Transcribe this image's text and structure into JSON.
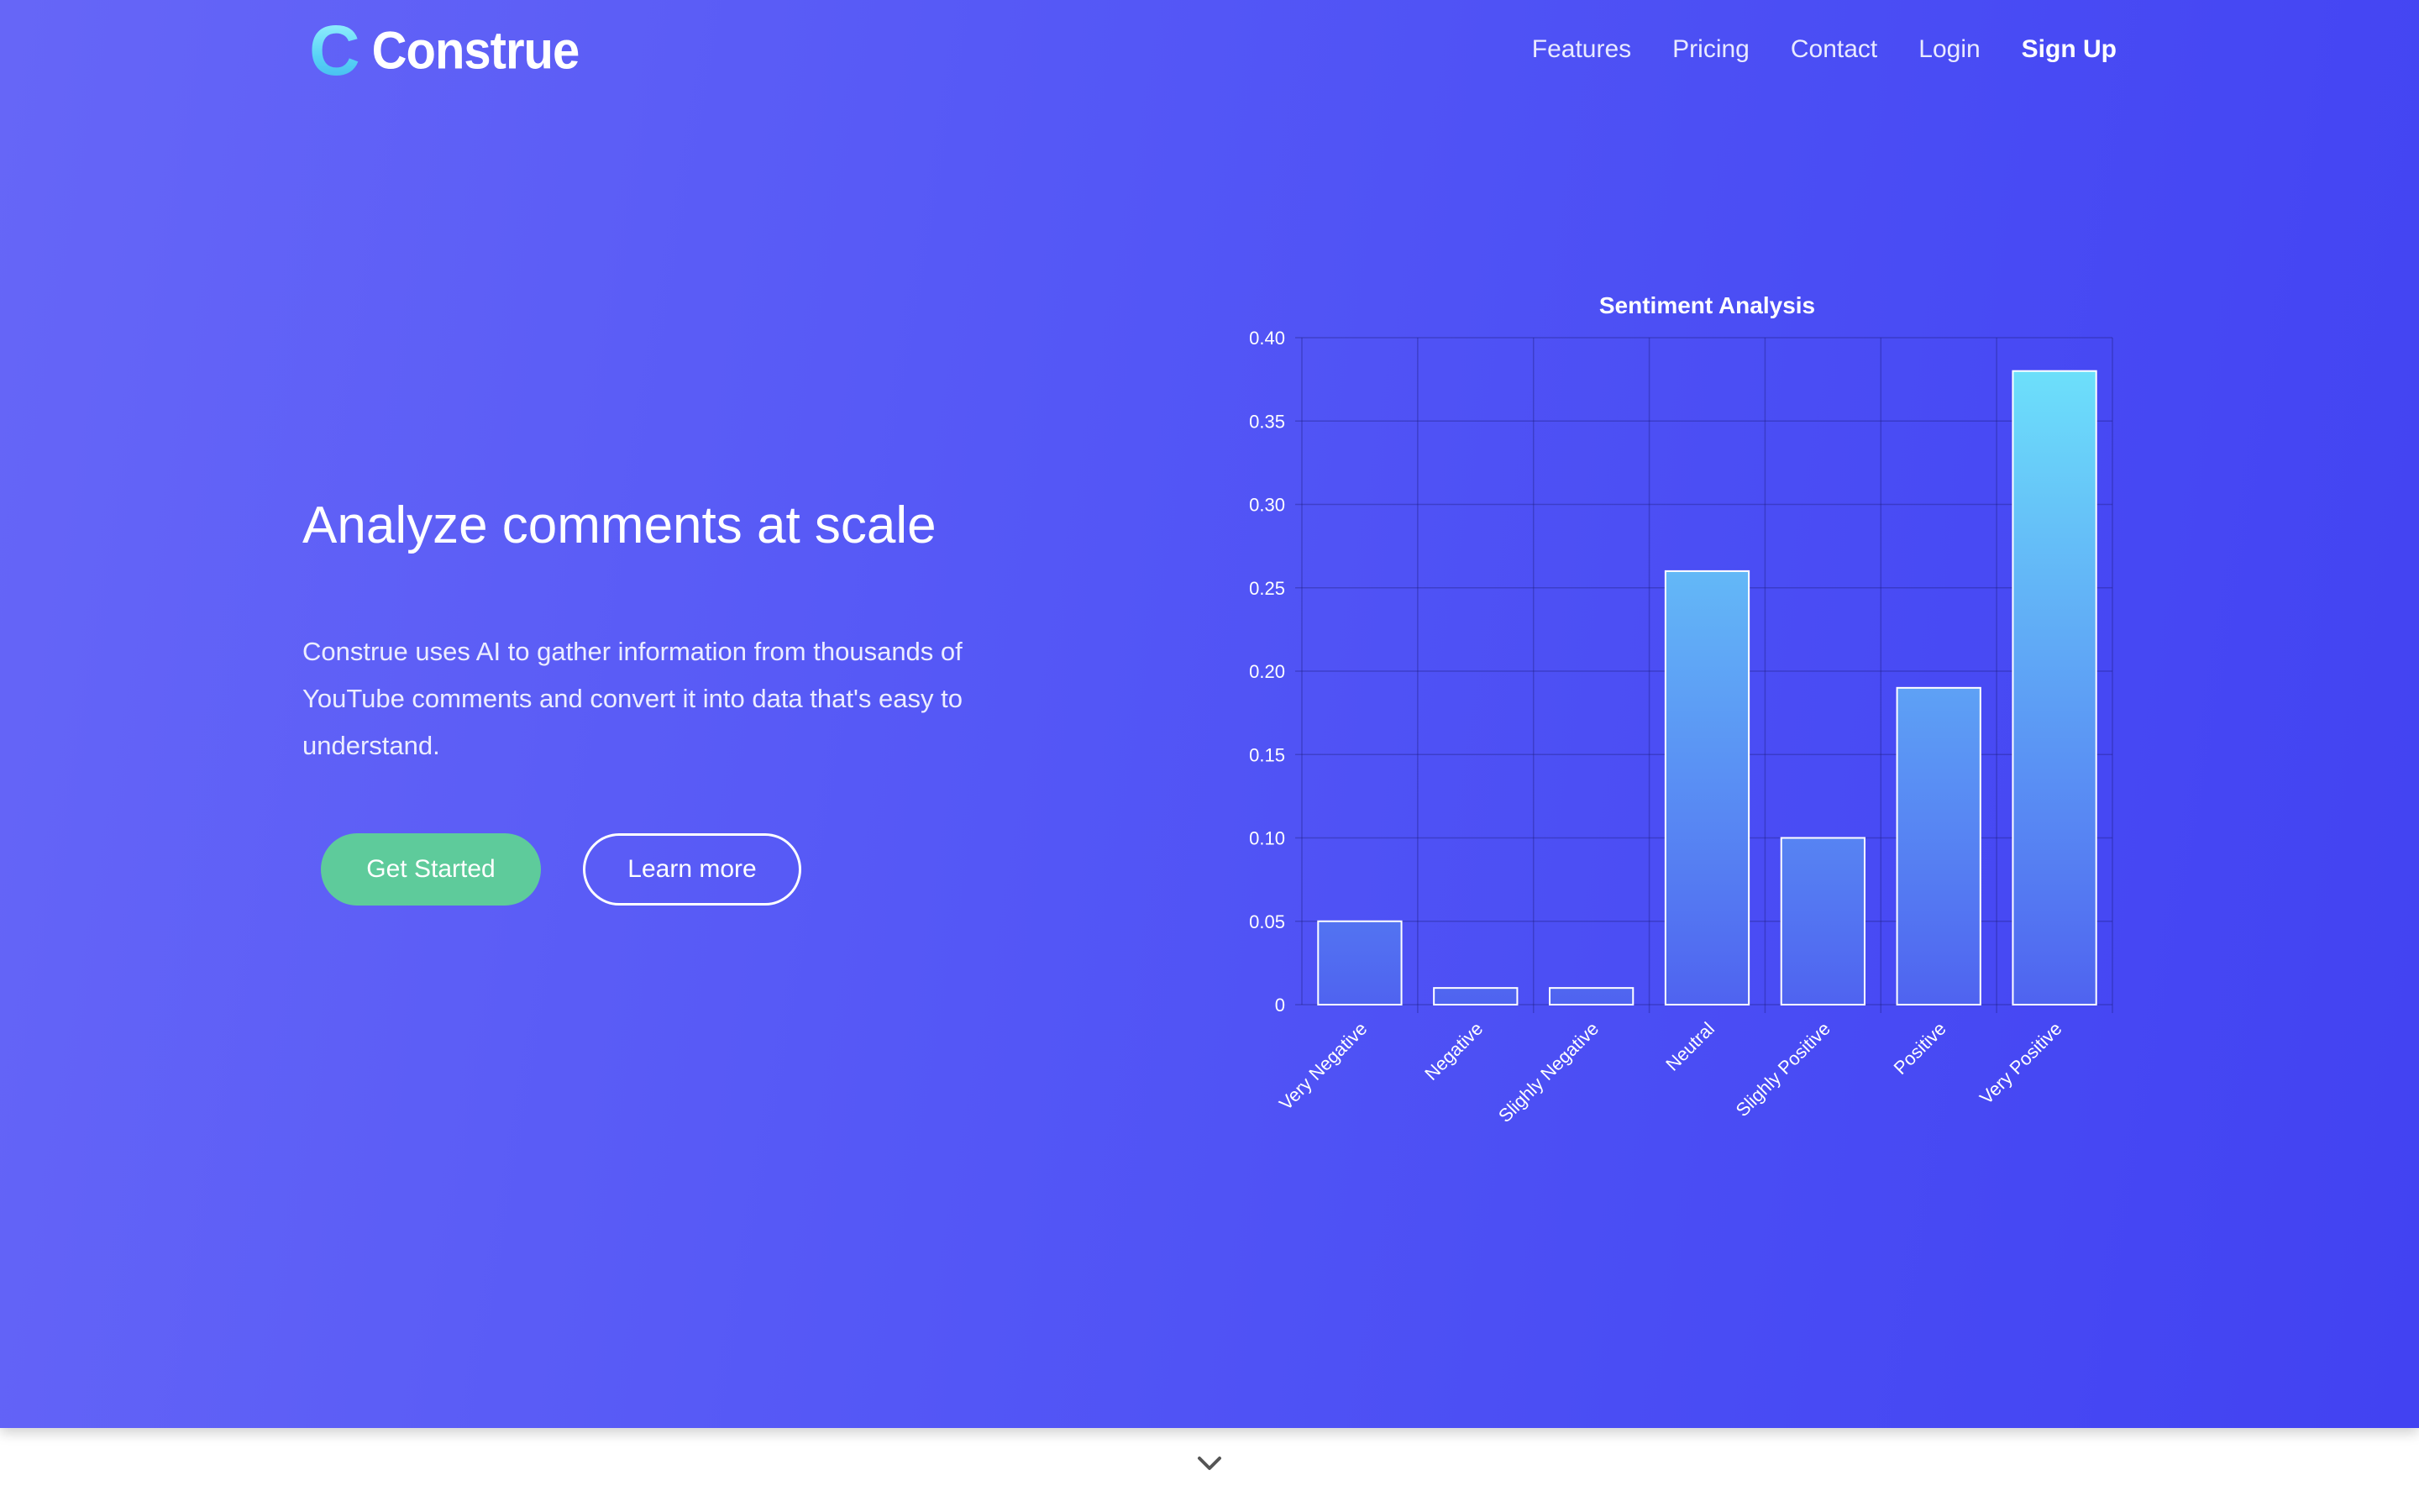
{
  "brand": {
    "mark": "C",
    "name": "Construe",
    "mark_gradient": [
      "#9ef3ff",
      "#43b8ef"
    ]
  },
  "nav": {
    "items": [
      {
        "label": "Features"
      },
      {
        "label": "Pricing"
      },
      {
        "label": "Contact"
      },
      {
        "label": "Login"
      },
      {
        "label": "Sign Up"
      }
    ]
  },
  "hero": {
    "headline": "Analyze comments at scale",
    "description": "Construe uses AI to gather information from thousands of YouTube comments and convert it into data that's easy to understand.",
    "primary_button": "Get Started",
    "secondary_button": "Learn more",
    "background_colors": [
      "#6666f7",
      "#4242f2"
    ],
    "primary_button_color": "#5ecb9b"
  },
  "scroll": {
    "icon": "chevron-down-icon"
  },
  "chart_data": {
    "type": "bar",
    "title": "Sentiment Analysis",
    "xlabel": "",
    "ylabel": "",
    "categories": [
      "Very Negative",
      "Negative",
      "Slighly Negative",
      "Neutral",
      "Slighly Positive",
      "Positive",
      "Very Positive"
    ],
    "values": [
      0.05,
      0.01,
      0.01,
      0.26,
      0.1,
      0.19,
      0.38
    ],
    "ylim": [
      0,
      0.4
    ],
    "yticks": [
      "0",
      "0.05",
      "0.10",
      "0.15",
      "0.20",
      "0.25",
      "0.30",
      "0.35",
      "0.40"
    ],
    "grid": true,
    "bar_gradient": [
      "#6ee6fb",
      "#4f63f0"
    ],
    "bar_border_color": "#ffffff"
  }
}
